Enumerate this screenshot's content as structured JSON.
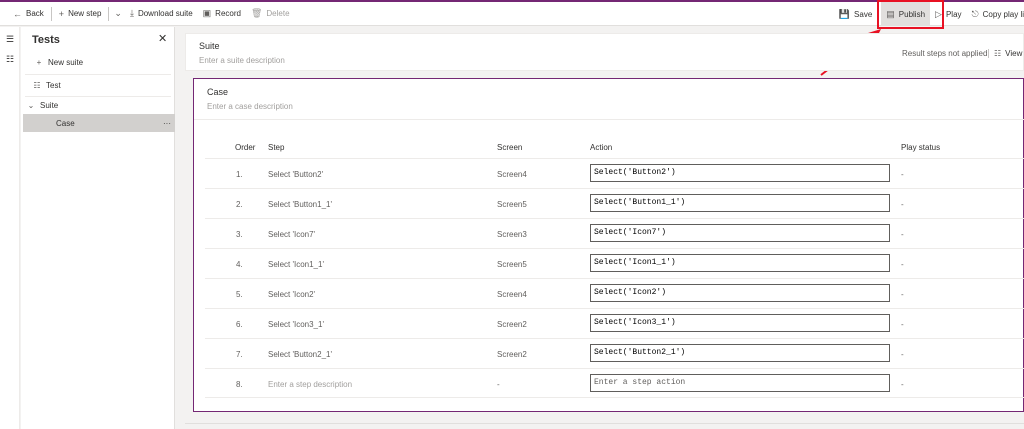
{
  "toolbar": {
    "back": "Back",
    "new_step": "New step",
    "download_suite": "Download suite",
    "record": "Record",
    "delete": "Delete",
    "save": "Save",
    "publish": "Publish",
    "play": "Play",
    "copy_play_link": "Copy play li"
  },
  "sidebar": {
    "title": "Tests",
    "new_suite": "New suite",
    "test_item": "Test",
    "tree": [
      {
        "label": "Suite"
      },
      {
        "label": "Case"
      }
    ]
  },
  "suite": {
    "title": "Suite",
    "description_placeholder": "Enter a suite description",
    "status": "Result steps not applied",
    "view": "View"
  },
  "case": {
    "title": "Case",
    "description_placeholder": "Enter a case description",
    "columns": [
      "Order",
      "Step",
      "Screen",
      "Action",
      "Play status"
    ],
    "rows": [
      {
        "order": "1.",
        "step": "Select 'Button2'",
        "screen": "Screen4",
        "action": "Select('Button2')",
        "status": "-"
      },
      {
        "order": "2.",
        "step": "Select 'Button1_1'",
        "screen": "Screen5",
        "action": "Select('Button1_1')",
        "status": "-"
      },
      {
        "order": "3.",
        "step": "Select 'Icon7'",
        "screen": "Screen3",
        "action": "Select('Icon7')",
        "status": "-"
      },
      {
        "order": "4.",
        "step": "Select 'Icon1_1'",
        "screen": "Screen5",
        "action": "Select('Icon1_1')",
        "status": "-"
      },
      {
        "order": "5.",
        "step": "Select 'Icon2'",
        "screen": "Screen4",
        "action": "Select('Icon2')",
        "status": "-"
      },
      {
        "order": "6.",
        "step": "Select 'Icon3_1'",
        "screen": "Screen2",
        "action": "Select('Icon3_1')",
        "status": "-"
      },
      {
        "order": "7.",
        "step": "Select 'Button2_1'",
        "screen": "Screen2",
        "action": "Select('Button2_1')",
        "status": "-"
      }
    ],
    "new_row": {
      "order": "8.",
      "step_placeholder": "Enter a step description",
      "screen": "-",
      "action_placeholder": "Enter a step action",
      "status": "-"
    }
  },
  "colors": {
    "accent": "#742774",
    "highlight": "#e81123"
  },
  "icons": [
    "back-arrow-icon",
    "add-icon",
    "download-icon",
    "record-icon",
    "delete-icon",
    "save-icon",
    "publish-icon",
    "play-icon",
    "copy-link-icon",
    "hamburger-icon",
    "test-studio-icon",
    "close-icon",
    "chevron-down-icon",
    "more-icon"
  ]
}
